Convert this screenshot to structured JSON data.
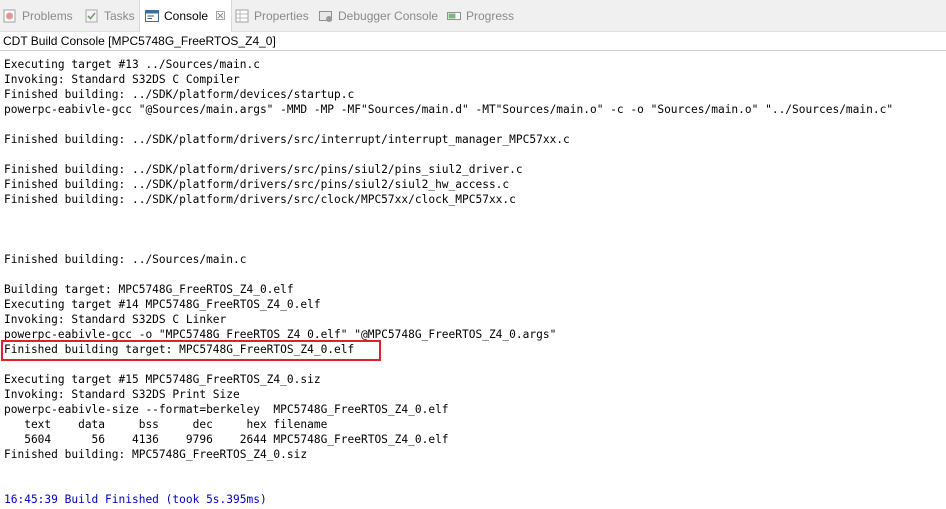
{
  "tabs": [
    {
      "label": "Problems",
      "icon": "problems-icon",
      "active": false
    },
    {
      "label": "Tasks",
      "icon": "tasks-icon",
      "active": false
    },
    {
      "label": "Console",
      "icon": "console-icon",
      "active": true,
      "close": "☒"
    },
    {
      "label": "Properties",
      "icon": "properties-icon",
      "active": false
    },
    {
      "label": "Debugger Console",
      "icon": "debugger-console-icon",
      "active": false
    },
    {
      "label": "Progress",
      "icon": "progress-icon",
      "active": false
    }
  ],
  "console_title": "CDT Build Console [MPC5748G_FreeRTOS_Z4_0]",
  "highlight_color": "#e0212b",
  "finish_text_color": "#0000c0",
  "lines": [
    "Executing target #13 ../Sources/main.c",
    "Invoking: Standard S32DS C Compiler",
    "Finished building: ../SDK/platform/devices/startup.c",
    "powerpc-eabivle-gcc \"@Sources/main.args\" -MMD -MP -MF\"Sources/main.d\" -MT\"Sources/main.o\" -c -o \"Sources/main.o\" \"../Sources/main.c\"",
    "",
    "Finished building: ../SDK/platform/drivers/src/interrupt/interrupt_manager_MPC57xx.c",
    "",
    "Finished building: ../SDK/platform/drivers/src/pins/siul2/pins_siul2_driver.c",
    "Finished building: ../SDK/platform/drivers/src/pins/siul2/siul2_hw_access.c",
    "Finished building: ../SDK/platform/drivers/src/clock/MPC57xx/clock_MPC57xx.c",
    "",
    "",
    "",
    "Finished building: ../Sources/main.c",
    "",
    "Building target: MPC5748G_FreeRTOS_Z4_0.elf",
    "Executing target #14 MPC5748G_FreeRTOS_Z4_0.elf",
    "Invoking: Standard S32DS C Linker",
    "powerpc-eabivle-gcc -o \"MPC5748G_FreeRTOS_Z4_0.elf\" \"@MPC5748G_FreeRTOS_Z4_0.args\"",
    "Finished building target: MPC5748G_FreeRTOS_Z4_0.elf",
    "",
    "Executing target #15 MPC5748G_FreeRTOS_Z4_0.siz",
    "Invoking: Standard S32DS Print Size",
    "powerpc-eabivle-size --format=berkeley  MPC5748G_FreeRTOS_Z4_0.elf",
    "   text    data     bss     dec     hex filename",
    "   5604      56    4136    9796    2644 MPC5748G_FreeRTOS_Z4_0.elf",
    "Finished building: MPC5748G_FreeRTOS_Z4_0.siz",
    "",
    "",
    "16:45:39 Build Finished (took 5s.395ms)"
  ]
}
